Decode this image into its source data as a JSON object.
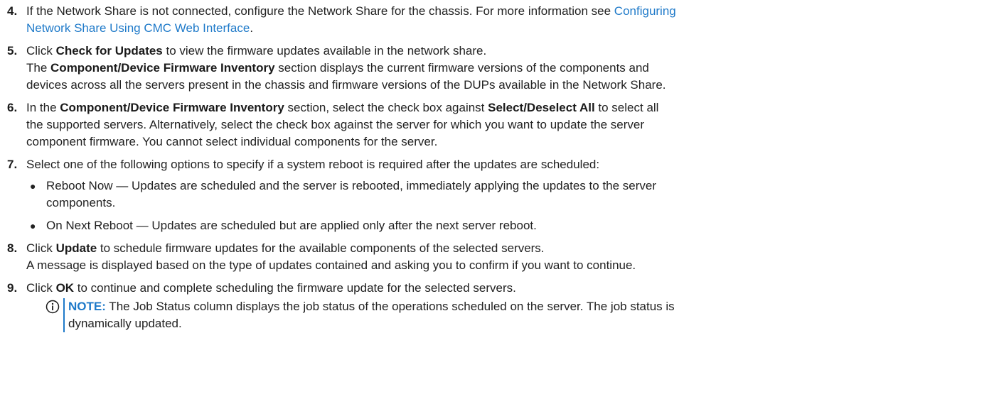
{
  "steps": {
    "s4": {
      "num": "4.",
      "text_a": "If the Network Share is not connected, configure the Network Share for the chassis. For more information see ",
      "link_a": "Configuring",
      "link_b": "Network Share Using CMC Web Interface",
      "text_end": "."
    },
    "s5": {
      "num": "5.",
      "pre": "Click ",
      "bold": "Check for Updates",
      "post": " to view the firmware updates available in the network share.",
      "l2_pre": "The ",
      "l2_bold": "Component/Device Firmware Inventory",
      "l2_post": " section displays the current firmware versions of the components and",
      "l3": "devices across all the servers present in the chassis and firmware versions of the DUPs available in the Network Share."
    },
    "s6": {
      "num": "6.",
      "pre": "In the ",
      "bold1": "Component/Device Firmware Inventory",
      "mid": " section, select the check box against ",
      "bold2": "Select/Deselect All",
      "post": " to select all",
      "l2": "the supported servers. Alternatively, select the check box against the server for which you want to update the server",
      "l3": "component firmware. You cannot select individual components for the server."
    },
    "s7": {
      "num": "7.",
      "text": "Select one of the following options to specify if a system reboot is required after the updates are scheduled:",
      "bullets": [
        {
          "l1": "Reboot Now — Updates are scheduled and the server is rebooted, immediately applying the updates to the server",
          "l2": "components."
        },
        {
          "l1": "On Next Reboot — Updates are scheduled but are applied only after the next server reboot.",
          "l2": ""
        }
      ]
    },
    "s8": {
      "num": "8.",
      "pre": "Click ",
      "bold": "Update",
      "post": " to schedule firmware updates for the available components of the selected servers.",
      "l2": "A message is displayed based on the type of updates contained and asking you to confirm if you want to continue."
    },
    "s9": {
      "num": "9.",
      "pre": "Click ",
      "bold": "OK",
      "post": " to continue and complete scheduling the firmware update for the selected servers."
    }
  },
  "note": {
    "icon": "info-circle-icon",
    "label": "NOTE:",
    "l1": " The Job Status column displays the job status of the operations scheduled on the server. The job status is",
    "l2": "dynamically updated."
  },
  "colors": {
    "link": "#1f7ac9",
    "text": "#222222"
  }
}
